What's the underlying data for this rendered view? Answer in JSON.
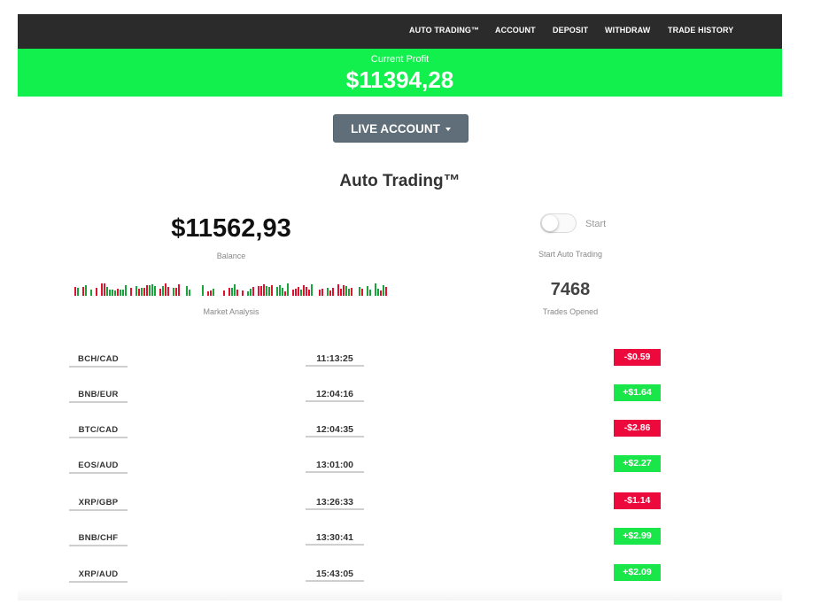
{
  "nav": {
    "items": [
      {
        "label": "AUTO TRADING™"
      },
      {
        "label": "ACCOUNT"
      },
      {
        "label": "DEPOSIT"
      },
      {
        "label": "WITHDRAW"
      },
      {
        "label": "TRADE HISTORY"
      }
    ],
    "bar_color": "#2b2b2b"
  },
  "profit": {
    "label": "Current Profit",
    "value": "$11394,28",
    "bar_color": "#12f04d"
  },
  "account_button": {
    "label": "LIVE ACCOUNT",
    "icon": "caret-down-icon"
  },
  "section_title": "Auto Trading™",
  "balance": {
    "value": "$11562,93",
    "label": "Balance"
  },
  "auto_trading_toggle": {
    "state_text": "Start",
    "caption": "Start Auto Trading",
    "enabled": false
  },
  "market_analysis": {
    "label": "Market Analysis",
    "up_color": "#1aa33a",
    "down_color": "#e0112f"
  },
  "trades_opened": {
    "value": "7468",
    "label": "Trades Opened"
  },
  "colors": {
    "gain": "#19e649",
    "loss": "#ec0a3d"
  },
  "trades": [
    {
      "pair": "BCH/CAD",
      "time": "11:13:25",
      "amount": "-$0.59",
      "direction": "loss"
    },
    {
      "pair": "BNB/EUR",
      "time": "12:04:16",
      "amount": "+$1.64",
      "direction": "gain"
    },
    {
      "pair": "BTC/CAD",
      "time": "12:04:35",
      "amount": "-$2.86",
      "direction": "loss"
    },
    {
      "pair": "EOS/AUD",
      "time": "13:01:00",
      "amount": "+$2.27",
      "direction": "gain"
    },
    {
      "pair": "XRP/GBP",
      "time": "13:26:33",
      "amount": "-$1.14",
      "direction": "loss"
    },
    {
      "pair": "BNB/CHF",
      "time": "13:30:41",
      "amount": "+$2.99",
      "direction": "gain"
    },
    {
      "pair": "XRP/AUD",
      "time": "15:43:05",
      "amount": "+$2.09",
      "direction": "gain"
    }
  ]
}
